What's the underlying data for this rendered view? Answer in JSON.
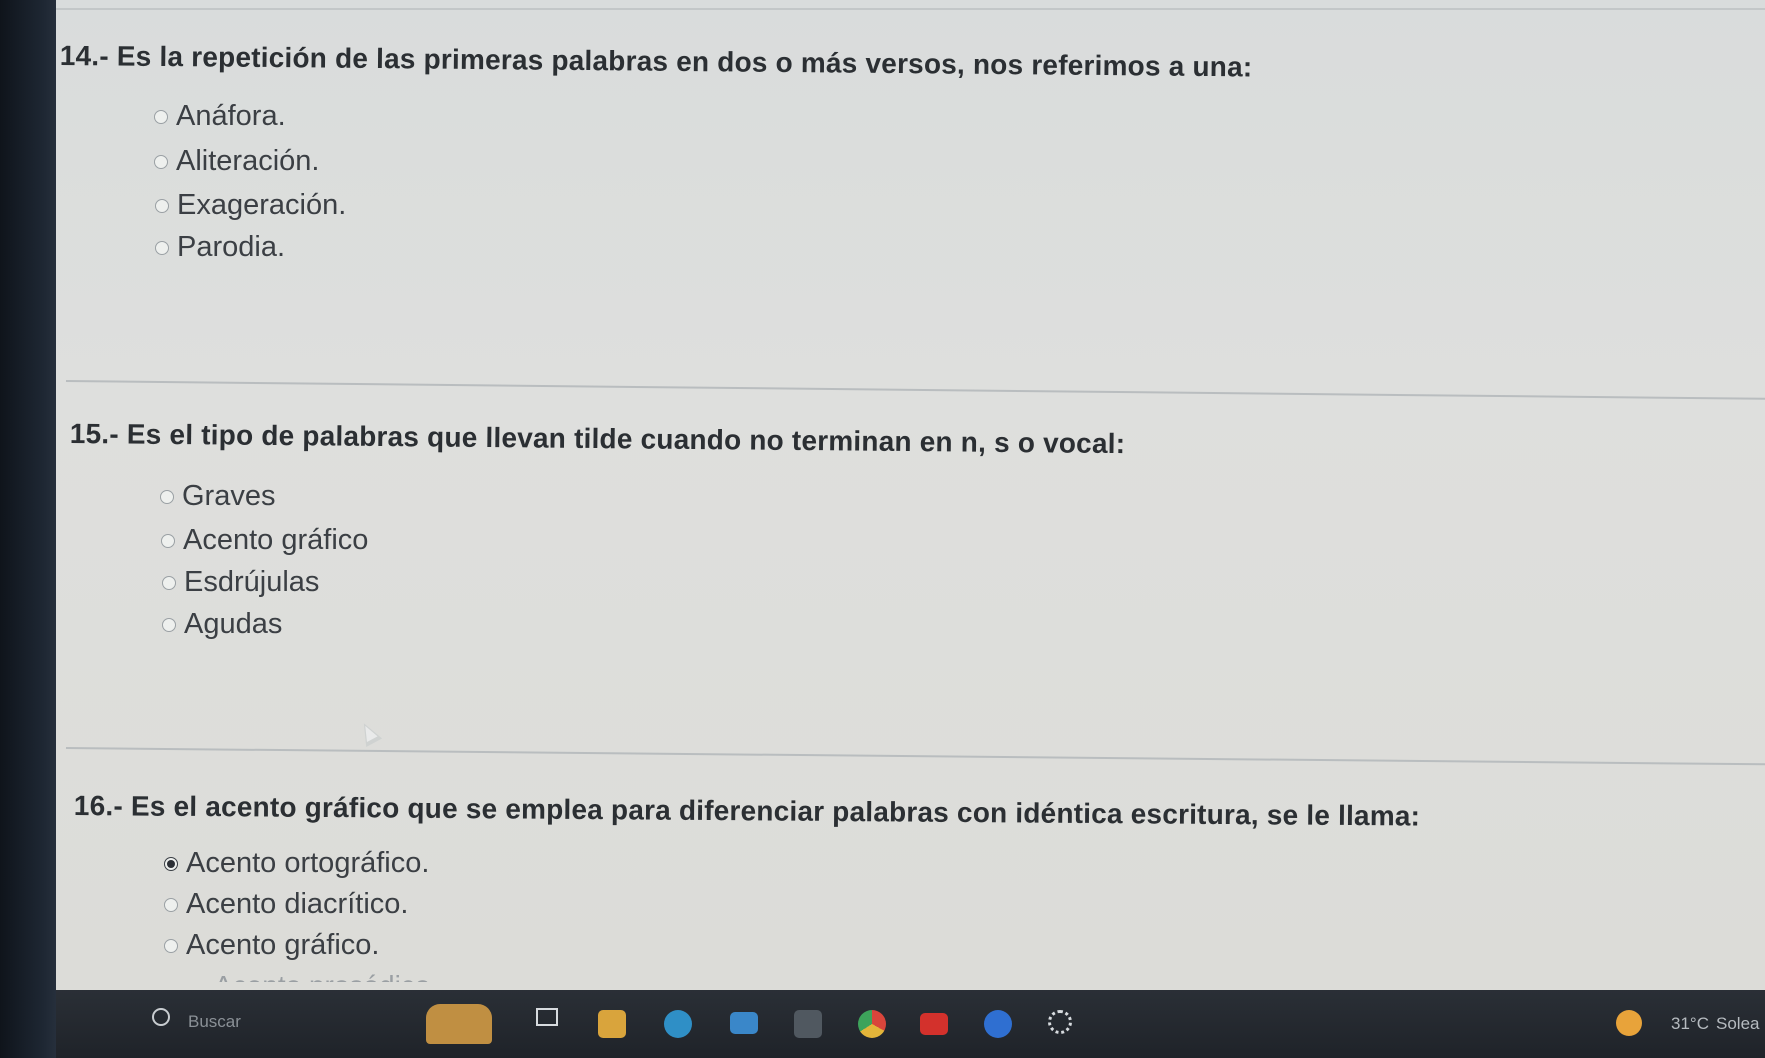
{
  "questions": [
    {
      "number": "14.-",
      "text": "Es la repetición de las primeras palabras en dos o más versos, nos referimos a una:",
      "options": [
        "Anáfora.",
        "Aliteración.",
        "Exageración.",
        "Parodia."
      ],
      "selected": null
    },
    {
      "number": "15.-",
      "text": "Es el tipo de palabras que llevan tilde cuando no terminan en n, s o vocal:",
      "options": [
        "Graves",
        "Acento gráfico",
        "Esdrújulas",
        "Agudas"
      ],
      "selected": null
    },
    {
      "number": "16.-",
      "text": "Es el acento gráfico que se emplea para diferenciar palabras con idéntica escritura, se le llama:",
      "options": [
        "Acento ortográfico.",
        "Acento diacrítico.",
        "Acento gráfico."
      ],
      "selected": "Acento ortográfico."
    }
  ],
  "cutoff_option": "Acento prosódico",
  "taskbar": {
    "search_placeholder": "Buscar",
    "temperature": "31°C",
    "weather": "Solea",
    "apps": [
      "start-icon",
      "search-icon",
      "widgets-icon",
      "task-view-icon",
      "file-explorer-icon",
      "edge-icon",
      "mail-icon",
      "store-icon",
      "chrome-icon",
      "youtube-icon",
      "facebook-icon",
      "settings-icon"
    ]
  },
  "colors": {
    "page": "#dcdedc",
    "taskbar": "#23282e",
    "selected": "#2c3036"
  }
}
